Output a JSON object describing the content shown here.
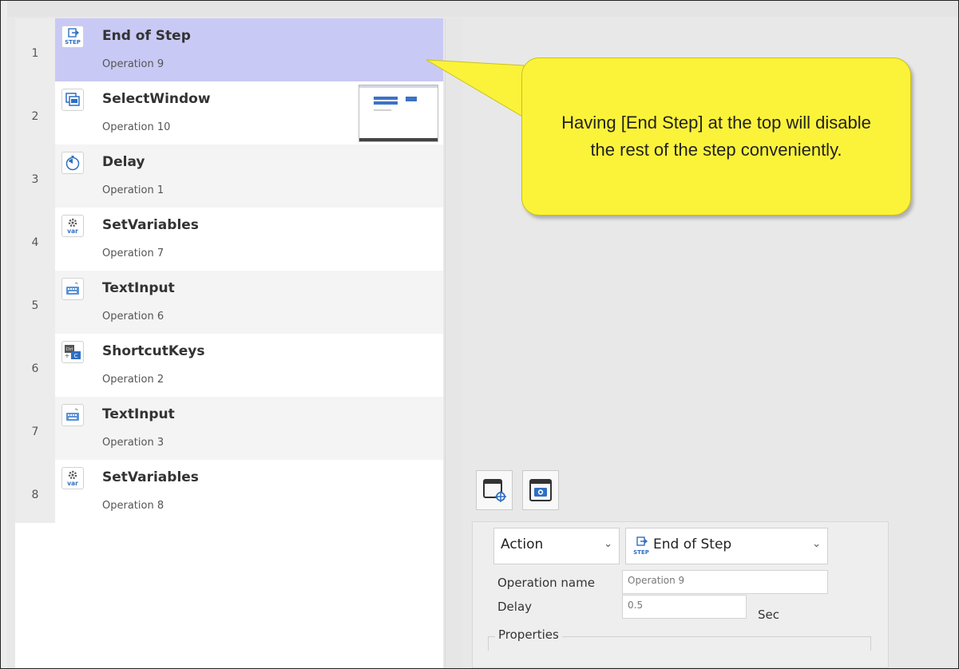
{
  "steps": [
    {
      "num": "1",
      "title": "End of Step",
      "sub": "Operation 9",
      "icon": "end-of-step-icon",
      "icon_text": "STEP"
    },
    {
      "num": "2",
      "title": "SelectWindow",
      "sub": "Operation 10",
      "icon": "select-window-icon"
    },
    {
      "num": "3",
      "title": "Delay",
      "sub": "Operation 1",
      "icon": "timer-icon"
    },
    {
      "num": "4",
      "title": "SetVariables",
      "sub": "Operation 7",
      "icon": "set-variables-icon",
      "icon_text": "var"
    },
    {
      "num": "5",
      "title": "TextInput",
      "sub": "Operation 6",
      "icon": "keyboard-icon"
    },
    {
      "num": "6",
      "title": "ShortcutKeys",
      "sub": "Operation 2",
      "icon": "shortcut-keys-icon",
      "icon_text": "Ctrl"
    },
    {
      "num": "7",
      "title": "TextInput",
      "sub": "Operation 3",
      "icon": "keyboard-icon"
    },
    {
      "num": "8",
      "title": "SetVariables",
      "sub": "Operation 8",
      "icon": "set-variables-icon",
      "icon_text": "var"
    }
  ],
  "callout": {
    "text": "Having [End Step] at the top will disable the rest of the step conveniently."
  },
  "properties": {
    "action_label": "Action",
    "action_value": "End of Step",
    "action_icon_text": "STEP",
    "operation_name_label": "Operation name",
    "operation_name_value": "Operation 9",
    "delay_label": "Delay",
    "delay_value": "0.5",
    "delay_unit": "Sec",
    "group_label": "Properties"
  },
  "colors": {
    "selected_row": "#c9c9f5",
    "callout": "#fbf33a",
    "icon_blue": "#2f6fc4"
  }
}
